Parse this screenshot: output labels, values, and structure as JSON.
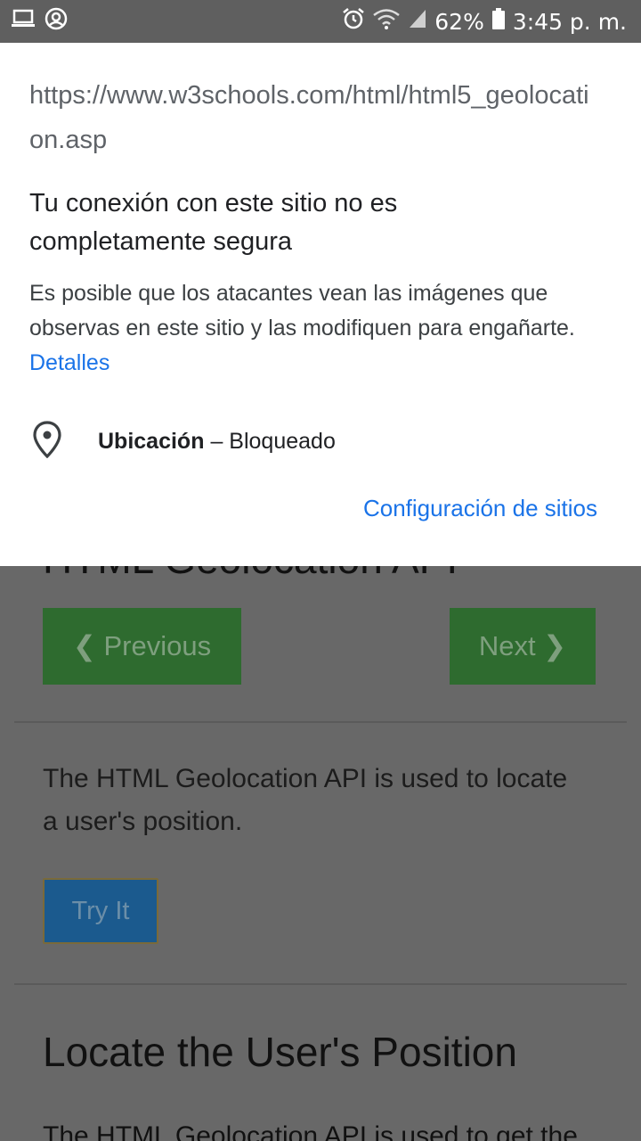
{
  "status_bar": {
    "left_icons": [
      "laptop-icon",
      "mention-icon"
    ],
    "right_icons": [
      "alarm-icon",
      "wifi-icon",
      "signal-icon",
      "battery-icon"
    ],
    "battery": "62%",
    "time": "3:45 p. m."
  },
  "dialog": {
    "url": "https://www.w3schools.com/html/html5_geolocation.asp",
    "connection_title": "Tu conexión con este sitio no es completamente segura",
    "connection_desc": "Es posible que los atacantes vean las imágenes que observas en este sitio y las modifiquen para engañarte.",
    "details_link": "Detalles",
    "permission": {
      "icon": "location-pin-icon",
      "name": "Ubicación",
      "separator": "–",
      "status": "Bloqueado"
    },
    "site_settings_link": "Configuración de sitios"
  },
  "page": {
    "title_partial": "HTML Geolocation API",
    "prev_label": "❮ Previous",
    "next_label": "Next ❯",
    "intro": "The HTML Geolocation API is used to locate a user's position.",
    "try_label": "Try It",
    "section_title": "Locate the User's Position",
    "section_text_partial": "The HTML Geolocation API is used to get the"
  },
  "colors": {
    "accent_link": "#1a73e8",
    "nav_button": "#2e6b2f",
    "try_button": "#1b5a8e",
    "overlay_gray": "#686868"
  }
}
